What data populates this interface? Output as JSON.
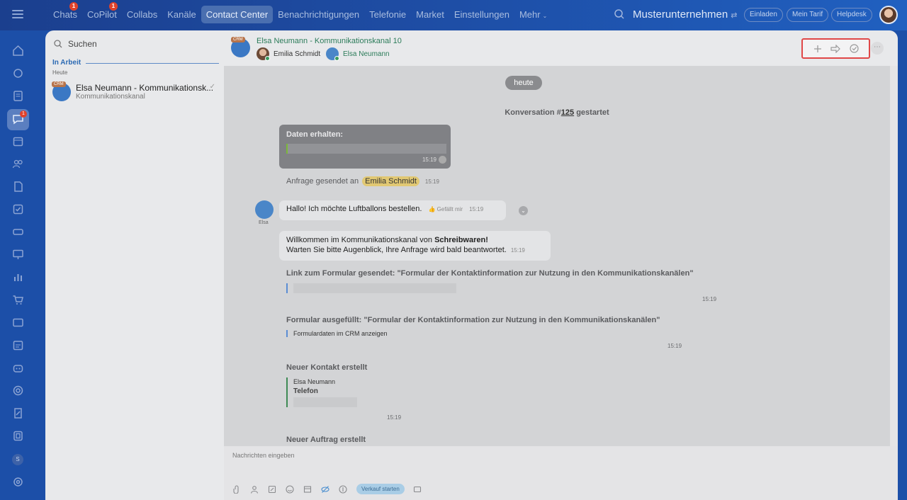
{
  "topbar": {
    "nav": [
      {
        "label": "Chats",
        "badge": "1"
      },
      {
        "label": "CoPilot",
        "badge": "1"
      },
      {
        "label": "Collabs"
      },
      {
        "label": "Kanäle"
      },
      {
        "label": "Contact Center",
        "active": true
      },
      {
        "label": "Benachrichtigungen"
      },
      {
        "label": "Telefonie"
      },
      {
        "label": "Market"
      },
      {
        "label": "Einstellungen"
      },
      {
        "label": "Mehr"
      }
    ],
    "company": "Musterunternehmen",
    "invite": "Einladen",
    "plan": "Mein Tarif",
    "helpdesk": "Helpdesk"
  },
  "rail": {
    "badge": "1",
    "user_initial": "S"
  },
  "list": {
    "search_placeholder": "Suchen",
    "section": "In Arbeit",
    "subsection": "Heute",
    "items": [
      {
        "crm": "CRM",
        "title": "Elsa Neumann - Kommunikationsk...",
        "subtitle": "Kommunikationskanal"
      }
    ]
  },
  "header": {
    "crm": "CRM",
    "title": "Elsa Neumann - Kommunikationskanal 10",
    "operator": "Emilia Schmidt",
    "client": "Elsa Neumann"
  },
  "messages": {
    "date": "heute",
    "conv_prefix": "Konversation #",
    "conv_number": "125",
    "conv_suffix": " gestartet",
    "data_card_title": "Daten erhalten:",
    "data_card_time": "15:19",
    "request_text": "Anfrage gesendet an",
    "request_name": "Emilia Schmidt",
    "request_time": "15:19",
    "customer_name": "Elsa",
    "customer_msg": "Hallo! Ich möchte Luftballons bestellen.",
    "like_label": "Gefällt mir",
    "customer_time": "15:19",
    "welcome_line1_prefix": "Willkommen im Kommunikationskanal von ",
    "welcome_line1_bold": "Schreibwaren!",
    "welcome_line2": "Warten Sie bitte Augenblick, Ihre Anfrage wird bald beantwortet.",
    "welcome_time": "15:19",
    "link_title": "Link zum Formular gesendet: \"Formular der Kontaktinformation zur Nutzung in den Kommunikationskanälen\"",
    "link_time": "15:19",
    "filled_title": "Formular ausgefüllt: \"Formular der Kontaktinformation zur Nutzung in den Kommunikationskanälen\"",
    "filled_link": "Formulardaten im CRM anzeigen",
    "filled_time": "15:19",
    "contact_title": "Neuer Kontakt erstellt",
    "contact_name": "Elsa Neumann",
    "contact_field": "Telefon",
    "contact_time": "15:19",
    "order_title": "Neuer Auftrag erstellt"
  },
  "composer": {
    "placeholder": "Nachrichten eingeben",
    "start_sale": "Verkauf starten"
  }
}
